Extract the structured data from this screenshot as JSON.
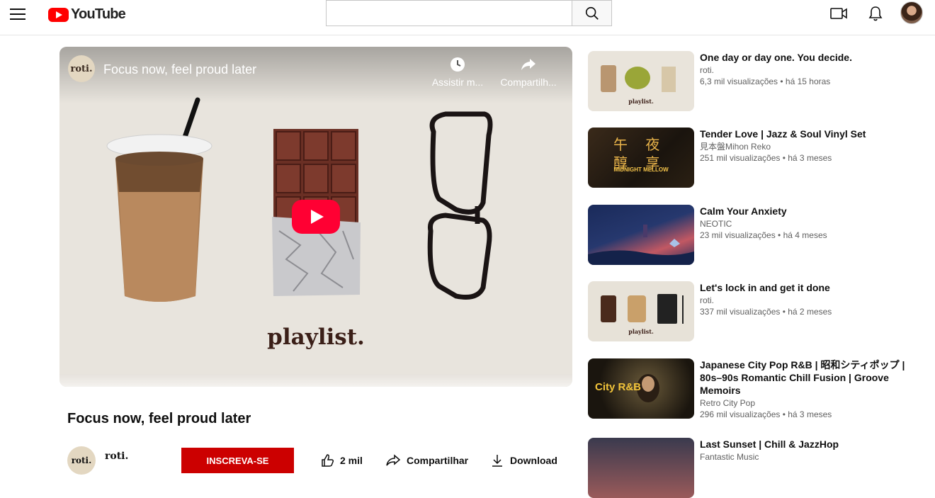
{
  "header": {
    "logo_text": "YouTube",
    "search_placeholder": "",
    "icons": [
      "menu-icon",
      "search-icon",
      "create-video-icon",
      "notifications-icon"
    ]
  },
  "player": {
    "channel_avatar_text": "roti.",
    "title": "Focus now, feel proud later",
    "watch_later_label": "Assistir m...",
    "share_label": "Compartilh...",
    "thumbnail_text": "playlist."
  },
  "video": {
    "title": "Focus now, feel proud later",
    "channel_avatar_text": "roti.",
    "channel_name": "roti.",
    "subscribe_label": "INSCREVA-SE",
    "likes_label": "2 mil",
    "share_label": "Compartilhar",
    "download_label": "Download"
  },
  "recommendations": [
    {
      "title": "One day or day one. You decide.",
      "channel": "roti.",
      "meta": "6,3 mil visualizações • há 15 horas",
      "thumb_text": "playlist."
    },
    {
      "title": "Tender Love | Jazz & Soul Vinyl Set",
      "channel": "見本盤Mihon Reko",
      "meta": "251 mil visualizações • há 3 meses",
      "thumb_text": "MIDNIGHT MELLOW"
    },
    {
      "title": "Calm Your Anxiety",
      "channel": "NEOTIC",
      "meta": "23 mil visualizações • há 4 meses",
      "thumb_text": ""
    },
    {
      "title": "Let's lock in and get it done",
      "channel": "roti.",
      "meta": "337 mil visualizações • há 2 meses",
      "thumb_text": "playlist."
    },
    {
      "title": "Japanese City Pop R&B | 昭和シティポップ | 80s–90s Romantic Chill Fusion | Groove Memoirs",
      "channel": "Retro City Pop",
      "meta": "296 mil visualizações • há 3 meses",
      "thumb_text": "City R&B"
    },
    {
      "title": "Last Sunset | Chill & JazzHop",
      "channel": "Fantastic Music",
      "meta": "",
      "thumb_text": ""
    }
  ],
  "colors": {
    "brand_red": "#ff0000",
    "subscribe_red": "#cc0000",
    "play_red": "#ff0033"
  }
}
